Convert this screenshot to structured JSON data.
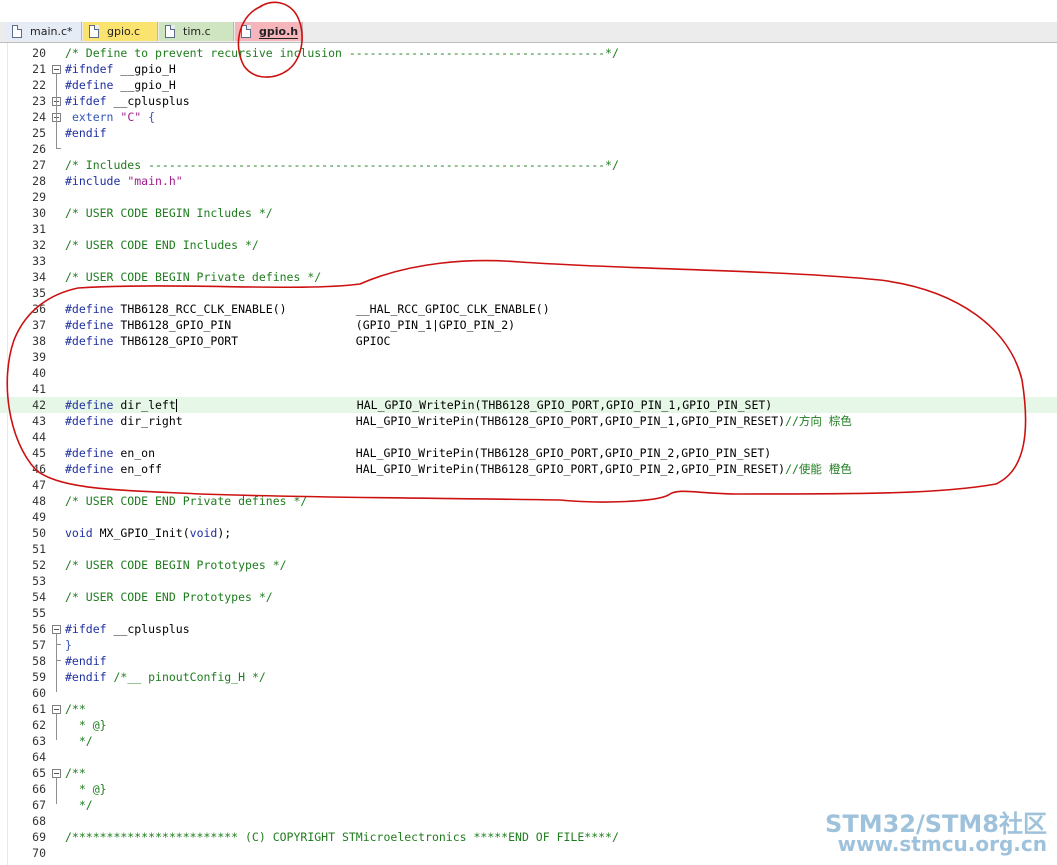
{
  "tabs": [
    {
      "label": "main.c*"
    },
    {
      "label": "gpio.c"
    },
    {
      "label": "tim.c"
    },
    {
      "label": "gpio.h"
    }
  ],
  "lines": [
    {
      "n": "20",
      "t": "/* Define to prevent recursive inclusion -------------------------------------*/",
      "k": "cmt"
    },
    {
      "n": "21",
      "t": "#ifndef __gpio_H",
      "k": "pp",
      "fold": "start"
    },
    {
      "n": "22",
      "t": "#define __gpio_H",
      "k": "pp"
    },
    {
      "n": "23",
      "t": "#ifdef __cplusplus",
      "k": "pp",
      "fold": "start"
    },
    {
      "n": "24",
      "t": " extern \"C\" {",
      "k": "extern",
      "fold": "start"
    },
    {
      "n": "25",
      "t": "#endif",
      "k": "pp"
    },
    {
      "n": "26",
      "t": "",
      "k": "plain",
      "fold": "end"
    },
    {
      "n": "27",
      "t": "/* Includes ------------------------------------------------------------------*/",
      "k": "cmt"
    },
    {
      "n": "28",
      "t": "#include \"main.h\"",
      "k": "include"
    },
    {
      "n": "29",
      "t": "",
      "k": "plain"
    },
    {
      "n": "30",
      "t": "/* USER CODE BEGIN Includes */",
      "k": "cmt"
    },
    {
      "n": "31",
      "t": "",
      "k": "plain"
    },
    {
      "n": "32",
      "t": "/* USER CODE END Includes */",
      "k": "cmt"
    },
    {
      "n": "33",
      "t": "",
      "k": "plain"
    },
    {
      "n": "34",
      "t": "/* USER CODE BEGIN Private defines */",
      "k": "cmt"
    },
    {
      "n": "35",
      "t": "",
      "k": "plain"
    },
    {
      "n": "36",
      "t": "#define THB6128_RCC_CLK_ENABLE()          __HAL_RCC_GPIOC_CLK_ENABLE()",
      "k": "define"
    },
    {
      "n": "37",
      "t": "#define THB6128_GPIO_PIN                  (GPIO_PIN_1|GPIO_PIN_2)",
      "k": "define"
    },
    {
      "n": "38",
      "t": "#define THB6128_GPIO_PORT                 GPIOC",
      "k": "define"
    },
    {
      "n": "39",
      "t": "",
      "k": "plain"
    },
    {
      "n": "40",
      "t": "",
      "k": "plain"
    },
    {
      "n": "41",
      "t": "",
      "k": "plain"
    },
    {
      "n": "42",
      "t": "#define dir_left                          HAL_GPIO_WritePin(THB6128_GPIO_PORT,GPIO_PIN_1,GPIO_PIN_SET)",
      "k": "define",
      "hl": true
    },
    {
      "n": "43",
      "t": "#define dir_right                         HAL_GPIO_WritePin(THB6128_GPIO_PORT,GPIO_PIN_1,GPIO_PIN_RESET)",
      "k": "define",
      "tail": "//方向 棕色"
    },
    {
      "n": "44",
      "t": "",
      "k": "plain"
    },
    {
      "n": "45",
      "t": "#define en_on                             HAL_GPIO_WritePin(THB6128_GPIO_PORT,GPIO_PIN_2,GPIO_PIN_SET)",
      "k": "define"
    },
    {
      "n": "46",
      "t": "#define en_off                            HAL_GPIO_WritePin(THB6128_GPIO_PORT,GPIO_PIN_2,GPIO_PIN_RESET)",
      "k": "define",
      "tail": "//使能 橙色"
    },
    {
      "n": "47",
      "t": "",
      "k": "plain"
    },
    {
      "n": "48",
      "t": "/* USER CODE END Private defines */",
      "k": "cmt"
    },
    {
      "n": "49",
      "t": "",
      "k": "plain"
    },
    {
      "n": "50",
      "t": "void MX_GPIO_Init(void);",
      "k": "void"
    },
    {
      "n": "51",
      "t": "",
      "k": "plain"
    },
    {
      "n": "52",
      "t": "/* USER CODE BEGIN Prototypes */",
      "k": "cmt"
    },
    {
      "n": "53",
      "t": "",
      "k": "plain"
    },
    {
      "n": "54",
      "t": "/* USER CODE END Prototypes */",
      "k": "cmt"
    },
    {
      "n": "55",
      "t": "",
      "k": "plain"
    },
    {
      "n": "56",
      "t": "#ifdef __cplusplus",
      "k": "pp",
      "fold": "start"
    },
    {
      "n": "57",
      "t": "}",
      "k": "plain",
      "fold": "end"
    },
    {
      "n": "58",
      "t": "#endif",
      "k": "pp",
      "fold": "endpp"
    },
    {
      "n": "59",
      "t": "#endif /*__ pinoutConfig_H */",
      "k": "pp"
    },
    {
      "n": "60",
      "t": "",
      "k": "plain"
    },
    {
      "n": "61",
      "t": "/**",
      "k": "cmt",
      "fold": "start"
    },
    {
      "n": "62",
      "t": "  * @}",
      "k": "cmt"
    },
    {
      "n": "63",
      "t": "  */",
      "k": "cmt"
    },
    {
      "n": "64",
      "t": "",
      "k": "plain"
    },
    {
      "n": "65",
      "t": "/**",
      "k": "cmt",
      "fold": "start"
    },
    {
      "n": "66",
      "t": "  * @}",
      "k": "cmt"
    },
    {
      "n": "67",
      "t": "  */",
      "k": "cmt"
    },
    {
      "n": "68",
      "t": "",
      "k": "plain"
    },
    {
      "n": "69",
      "t": "/************************ (C) COPYRIGHT STMicroelectronics *****END OF FILE****/",
      "k": "cmt"
    },
    {
      "n": "70",
      "t": "",
      "k": "plain"
    }
  ],
  "watermark": {
    "line1": "STM32/STM8社区",
    "line2": "www.stmcu.org.cn"
  },
  "colors": {
    "comment": "#1e7d1e",
    "preprocessor": "#1e2ea0",
    "string": "#a01e8c",
    "annotation": "#cc1111",
    "highlight": "#e7f7e7"
  }
}
